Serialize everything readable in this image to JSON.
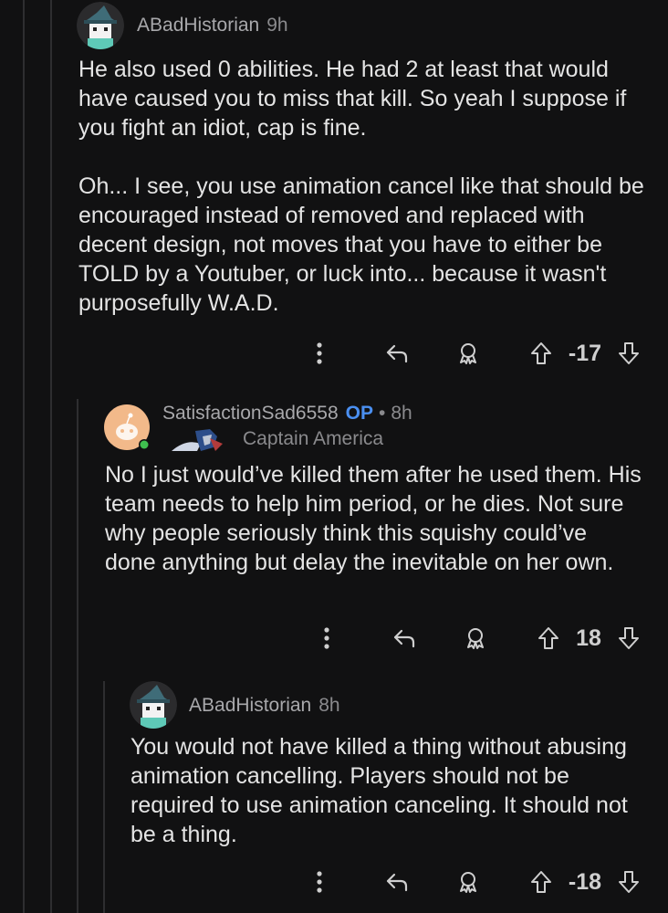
{
  "comments": [
    {
      "username": "ABadHistorian",
      "time": "9h",
      "paragraphs": [
        "He also used 0 abilities. He had 2 at least that would have caused you to miss that kill. So yeah I suppose if you fight an idiot, cap is fine.",
        "Oh... I see, you use animation cancel like that should be encouraged instead of removed and replaced with decent design, not moves that you have to either be TOLD by a Youtuber, or luck into... because it wasn't purposefully W.A.D."
      ],
      "score": "-17",
      "avatar_icon": "witch-hat-avatar-icon"
    },
    {
      "username": "SatisfactionSad6558",
      "op_badge": "OP",
      "separator": "•",
      "time": "8h",
      "flair": "Captain America",
      "paragraphs": [
        "No I just would’ve killed them after he used them. His team needs to help him period, or he dies. Not sure why people seriously think this squishy could’ve done anything but delay the inevitable on her own."
      ],
      "score": "18",
      "avatar_icon": "snoo-avatar-icon"
    },
    {
      "username": "ABadHistorian",
      "time": "8h",
      "paragraphs": [
        "You would not have killed a thing without abusing animation cancelling. Players should not be required to use animation canceling. It should not be a thing."
      ],
      "score": "-18",
      "avatar_icon": "witch-hat-avatar-icon"
    }
  ],
  "colors": {
    "background": "#111112",
    "op": "#4a8ff0",
    "online": "#3fbf4f"
  }
}
